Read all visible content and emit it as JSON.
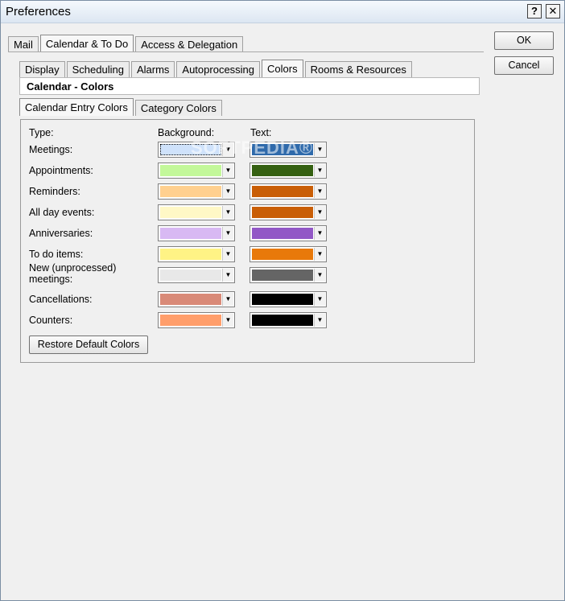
{
  "window": {
    "title": "Preferences",
    "help_label": "?",
    "close_label": "✕"
  },
  "main_tabs": [
    "Mail",
    "Calendar & To Do",
    "Access & Delegation"
  ],
  "main_tab_active": "Calendar & To Do",
  "sub_tabs": [
    "Display",
    "Scheduling",
    "Alarms",
    "Autoprocessing",
    "Colors",
    "Rooms & Resources"
  ],
  "sub_tab_active": "Colors",
  "section_title": "Calendar - Colors",
  "color_tabs": [
    "Calendar Entry Colors",
    "Category Colors"
  ],
  "color_tab_active": "Calendar Entry Colors",
  "columns": {
    "type": "Type:",
    "background": "Background:",
    "text": "Text:"
  },
  "rows": [
    {
      "label": "Meetings:",
      "bg": "#cfe2fb",
      "fg": "#2f6aab"
    },
    {
      "label": "Appointments:",
      "bg": "#c3f89a",
      "fg": "#356112"
    },
    {
      "label": "Reminders:",
      "bg": "#ffd08f",
      "fg": "#c95e06"
    },
    {
      "label": "All day events:",
      "bg": "#fff8c6",
      "fg": "#c95e06"
    },
    {
      "label": "Anniversaries:",
      "bg": "#d8b9f3",
      "fg": "#9258c6"
    },
    {
      "label": "To do items:",
      "bg": "#fff385",
      "fg": "#e8790a"
    },
    {
      "label": "New (unprocessed)\nmeetings:",
      "bg": "#e8e8e8",
      "fg": "#656565"
    },
    {
      "label": "Cancellations:",
      "bg": "#d98a78",
      "fg": "#000000"
    },
    {
      "label": "Counters:",
      "bg": "#ff9e6b",
      "fg": "#000000"
    }
  ],
  "restore_label": "Restore Default Colors",
  "ok_label": "OK",
  "cancel_label": "Cancel",
  "watermark": "SOFTPEDIA®"
}
